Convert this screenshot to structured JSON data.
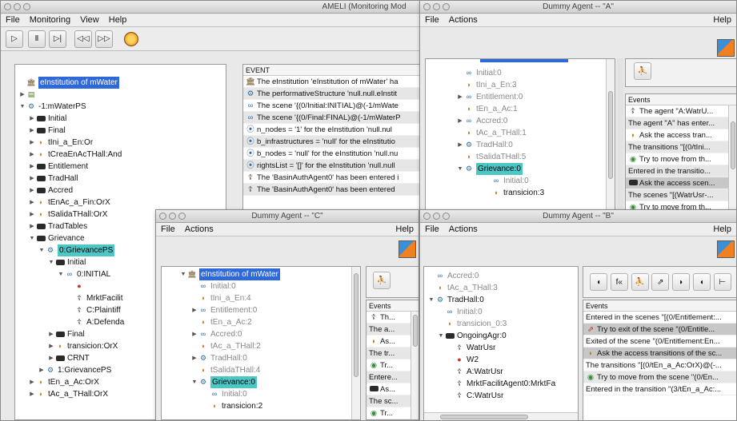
{
  "ameli": {
    "title": "AMELI (Monitoring Mod",
    "menu": [
      "File",
      "Monitoring",
      "View",
      "Help"
    ],
    "toolbar": [
      "play",
      "pause",
      "step",
      "rewind",
      "fast-forward",
      "clock"
    ],
    "tree": [
      {
        "t": "eInstitution of mWater",
        "icon": "institution-icon",
        "lvl": 0,
        "sel": true
      },
      {
        "t": "",
        "icon": "list-icon",
        "lvl": 0,
        "tw": "▶"
      },
      {
        "t": "-1:mWaterPS",
        "icon": "ps-icon",
        "lvl": 0,
        "tw": "▼"
      },
      {
        "t": "Initial",
        "icon": "scene-icon",
        "lvl": 1,
        "tw": "▶"
      },
      {
        "t": "Final",
        "icon": "scene-icon",
        "lvl": 1,
        "tw": "▶"
      },
      {
        "t": "tIni_a_En:Or",
        "icon": "transition-icon",
        "lvl": 1,
        "tw": "▶"
      },
      {
        "t": "tCreaEnAcTHall:And",
        "icon": "transition-icon",
        "lvl": 1,
        "tw": "▶"
      },
      {
        "t": "Entitlement",
        "icon": "scene-icon",
        "lvl": 1,
        "tw": "▶"
      },
      {
        "t": "TradHall",
        "icon": "scene-icon",
        "lvl": 1,
        "tw": "▶"
      },
      {
        "t": "Accred",
        "icon": "scene-icon",
        "lvl": 1,
        "tw": "▶"
      },
      {
        "t": "tEnAc_a_Fin:OrX",
        "icon": "transition-icon",
        "lvl": 1,
        "tw": "▶"
      },
      {
        "t": "tSalidaTHall:OrX",
        "icon": "transition-icon",
        "lvl": 1,
        "tw": "▶"
      },
      {
        "t": "TradTables",
        "icon": "scene-icon",
        "lvl": 1,
        "tw": "▶"
      },
      {
        "t": "Grievance",
        "icon": "scene-icon",
        "lvl": 1,
        "tw": "▼"
      },
      {
        "t": "0:GrievancePS",
        "icon": "ps-icon",
        "lvl": 2,
        "tw": "▼",
        "sel2": true
      },
      {
        "t": "Initial",
        "icon": "scene-icon",
        "lvl": 3,
        "tw": "▼"
      },
      {
        "t": "0:INITIAL",
        "icon": "state-icon",
        "lvl": 4,
        "tw": "▼"
      },
      {
        "t": "",
        "icon": "agent-w-icon",
        "lvl": 5
      },
      {
        "t": "MrktFacilit",
        "icon": "person-icon",
        "lvl": 5
      },
      {
        "t": "C:Plaintiff",
        "icon": "person-icon",
        "lvl": 5
      },
      {
        "t": "A:Defenda",
        "icon": "person-icon",
        "lvl": 5
      },
      {
        "t": "Final",
        "icon": "scene-icon",
        "lvl": 3,
        "tw": "▶"
      },
      {
        "t": "transicion:OrX",
        "icon": "transition-icon",
        "lvl": 3,
        "tw": "▶"
      },
      {
        "t": "CRNT",
        "icon": "scene-icon",
        "lvl": 3,
        "tw": "▶"
      },
      {
        "t": "1:GrievancePS",
        "icon": "ps-icon",
        "lvl": 2,
        "tw": "▶"
      },
      {
        "t": "tEn_a_Ac:OrX",
        "icon": "transition-icon",
        "lvl": 1,
        "tw": "▶"
      },
      {
        "t": "tAc_a_THall:OrX",
        "icon": "transition-icon",
        "lvl": 1,
        "tw": "▶"
      }
    ],
    "events_header": "EVENT",
    "events": [
      {
        "t": "The eInstitution 'eInstitution of mWater' ha",
        "icon": "institution-icon"
      },
      {
        "t": "The performativeStructure 'null.null.eInstit",
        "icon": "ps-icon"
      },
      {
        "t": "The scene '{(0/Initial:INITIAL)@(-1/mWate",
        "icon": "state-icon"
      },
      {
        "t": "The scene '{(0/Final:FINAL)@(-1/mWaterP",
        "icon": "state-icon"
      },
      {
        "t": "n_nodes = '1' for the eInstitution 'null.nul",
        "icon": "var-icon"
      },
      {
        "t": "b_infrastructures = 'null' for the eInstitutio",
        "icon": "var-icon"
      },
      {
        "t": "b_nodes = 'null' for the eInstitution 'null.nu",
        "icon": "var-icon"
      },
      {
        "t": "rightsList = '[]' for the eInstitution 'null.null",
        "icon": "var-icon"
      },
      {
        "t": "The 'BasinAuthAgent0' has been entered i",
        "icon": "person-icon"
      },
      {
        "t": "The 'BasinAuthAgent0' has been entered",
        "icon": "person-icon"
      }
    ]
  },
  "agentA": {
    "title": "Dummy Agent  --  \"A\"",
    "menu": [
      "File",
      "Actions"
    ],
    "help": "Help",
    "tree": [
      {
        "t": "Initial:0",
        "icon": "state-icon",
        "lvl": 1,
        "gray": true
      },
      {
        "t": "tIni_a_En:3",
        "icon": "transition-icon",
        "lvl": 1,
        "gray": true
      },
      {
        "t": "Entitlement:0",
        "icon": "state-icon",
        "lvl": 1,
        "gray": true,
        "tw": "▶"
      },
      {
        "t": "tEn_a_Ac:1",
        "icon": "transition-icon",
        "lvl": 1,
        "gray": true
      },
      {
        "t": "Accred:0",
        "icon": "state-icon",
        "lvl": 1,
        "gray": true,
        "tw": "▶"
      },
      {
        "t": "tAc_a_THall:1",
        "icon": "transition-icon",
        "lvl": 1,
        "gray": true
      },
      {
        "t": "TradHall:0",
        "icon": "ps-icon",
        "lvl": 1,
        "gray": true,
        "tw": "▶"
      },
      {
        "t": "tSalidaTHall:5",
        "icon": "transition-icon",
        "lvl": 1,
        "gray": true
      },
      {
        "t": "Grievance:0",
        "icon": "ps-icon",
        "lvl": 1,
        "tw": "▼",
        "sel2": true
      },
      {
        "t": "Initial:0",
        "icon": "state-icon",
        "lvl": 2,
        "gray": true
      },
      {
        "t": "transicion:3",
        "icon": "transition-icon",
        "lvl": 2
      }
    ],
    "events_header": "Events",
    "events": [
      {
        "t": "The agent \"A:WatrU...",
        "icon": "person-icon"
      },
      {
        "t": "The agent \"A\" has enter...",
        "icon": ""
      },
      {
        "t": "Ask the access tran...",
        "icon": "transition-icon"
      },
      {
        "t": "The transitions \"[(0/tIni...",
        "icon": ""
      },
      {
        "t": "Try to move from th...",
        "icon": "move-icon"
      },
      {
        "t": "Entered in the transitio...",
        "icon": ""
      },
      {
        "t": "Ask the access scen...",
        "icon": "scene-icon"
      },
      {
        "t": "The scenes \"[(WatrUsr-...",
        "icon": ""
      },
      {
        "t": "Try to move from th...",
        "icon": "move-icon"
      }
    ]
  },
  "agentC": {
    "title": "Dummy Agent  --  \"C\"",
    "menu": [
      "File",
      "Actions"
    ],
    "help": "Help",
    "tree": [
      {
        "t": "eInstitution of mWater",
        "icon": "institution-icon",
        "lvl": 0,
        "tw": "▼",
        "sel": true
      },
      {
        "t": "Initial:0",
        "icon": "state-icon",
        "lvl": 1,
        "gray": true
      },
      {
        "t": "tIni_a_En:4",
        "icon": "transition-icon",
        "lvl": 1,
        "gray": true
      },
      {
        "t": "Entitlement:0",
        "icon": "state-icon",
        "lvl": 1,
        "gray": true,
        "tw": "▶"
      },
      {
        "t": "tEn_a_Ac:2",
        "icon": "transition-icon",
        "lvl": 1,
        "gray": true
      },
      {
        "t": "Accred:0",
        "icon": "state-icon",
        "lvl": 1,
        "gray": true,
        "tw": "▶"
      },
      {
        "t": "tAc_a_THall:2",
        "icon": "transition-icon",
        "lvl": 1,
        "gray": true
      },
      {
        "t": "TradHall:0",
        "icon": "ps-icon",
        "lvl": 1,
        "gray": true,
        "tw": "▶"
      },
      {
        "t": "tSalidaTHall:4",
        "icon": "transition-icon",
        "lvl": 1,
        "gray": true
      },
      {
        "t": "Grievance:0",
        "icon": "ps-icon",
        "lvl": 1,
        "tw": "▼",
        "sel2": true
      },
      {
        "t": "Initial:0",
        "icon": "state-icon",
        "lvl": 2,
        "gray": true
      },
      {
        "t": "transicion:2",
        "icon": "transition-icon",
        "lvl": 2
      }
    ],
    "events_header": "Events",
    "events": [
      {
        "t": "Th...",
        "icon": "person-icon"
      },
      {
        "t": "The a...",
        "icon": ""
      },
      {
        "t": "As...",
        "icon": "transition-icon"
      },
      {
        "t": "The tr...",
        "icon": ""
      },
      {
        "t": "Tr...",
        "icon": "move-icon"
      },
      {
        "t": "Entere...",
        "icon": ""
      },
      {
        "t": "As...",
        "icon": "scene-icon"
      },
      {
        "t": "The sc...",
        "icon": ""
      },
      {
        "t": "Tr...",
        "icon": "move-icon"
      }
    ]
  },
  "agentB": {
    "title": "Dummy Agent  --  \"B\"",
    "menu": [
      "File",
      "Actions"
    ],
    "help": "Help",
    "tree": [
      {
        "t": "Accred:0",
        "icon": "state-icon",
        "lvl": 0,
        "gray": true
      },
      {
        "t": "tAc_a_THall:3",
        "icon": "transition-icon",
        "lvl": 0,
        "gray": true
      },
      {
        "t": "TradHall:0",
        "icon": "ps-icon",
        "lvl": 0,
        "tw": "▼"
      },
      {
        "t": "Initial:0",
        "icon": "state-icon",
        "lvl": 1,
        "gray": true
      },
      {
        "t": "transicion_0:3",
        "icon": "transition-icon",
        "lvl": 1,
        "gray": true
      },
      {
        "t": "OngoingAgr:0",
        "icon": "scene-icon",
        "lvl": 1,
        "tw": "▼"
      },
      {
        "t": "WatrUsr",
        "icon": "person-icon",
        "lvl": 2
      },
      {
        "t": "W2",
        "icon": "agent-w-icon",
        "lvl": 2
      },
      {
        "t": "A:WatrUsr",
        "icon": "person-icon",
        "lvl": 2
      },
      {
        "t": "MrktFacilitAgent0:MrktFa",
        "icon": "person-icon",
        "lvl": 2
      },
      {
        "t": "C:WatrUsr",
        "icon": "person-icon",
        "lvl": 2
      }
    ],
    "events_header": "Events",
    "events": [
      {
        "t": "Entered in the scenes \"[(0/Entitlement:...",
        "icon": ""
      },
      {
        "t": "Try to exit of the scene \"(0/Entitle...",
        "icon": "exit-icon"
      },
      {
        "t": "Exited of the scene \"(0/Entitlement:En...",
        "icon": ""
      },
      {
        "t": "Ask the access transitions of the sc...",
        "icon": "transition-icon"
      },
      {
        "t": "The transitions \"[(0/tEn_a_Ac:OrX)@(-...",
        "icon": ""
      },
      {
        "t": "Try to move from the scene \"(0/En...",
        "icon": "move-icon"
      },
      {
        "t": "Entered in the transition \"(3/tEn_a_Ac:...",
        "icon": ""
      }
    ]
  }
}
